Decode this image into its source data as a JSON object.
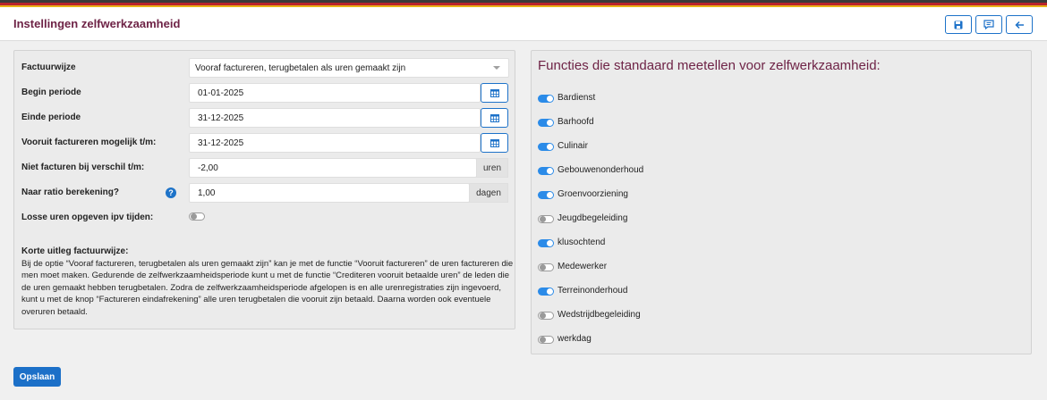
{
  "header": {
    "title": "Instellingen zelfwerkzaamheid",
    "buttons": [
      {
        "icon": "save-icon"
      },
      {
        "icon": "comment-icon"
      },
      {
        "icon": "arrow-left-icon"
      }
    ]
  },
  "colors": {
    "accent": "#1d72c9",
    "title": "#6e2346",
    "toggle_on": "#2b8be8"
  },
  "settings": {
    "factuurwijze": {
      "label": "Factuurwijze",
      "value": "Vooraf factureren, terugbetalen als uren gemaakt zijn"
    },
    "begin_periode": {
      "label": "Begin periode",
      "value": "01-01-2025"
    },
    "einde_periode": {
      "label": "Einde periode",
      "value": "31-12-2025"
    },
    "vooruit": {
      "label": "Vooruit factureren mogelijk t/m:",
      "value": "31-12-2025"
    },
    "niet_facturen": {
      "label": "Niet facturen bij verschil t/m:",
      "value": "-2,00",
      "unit": "uren"
    },
    "ratio": {
      "label": "Naar ratio berekening?",
      "value": "1,00",
      "unit": "dagen"
    },
    "losse_uren": {
      "label": "Losse uren opgeven ipv tijden:",
      "enabled": false
    }
  },
  "explanation": {
    "title": "Korte uitleg factuurwijze:",
    "text": "Bij de optie “Vooraf factureren, terugbetalen als uren gemaakt zijn” kan je met de functie “Vooruit factureren” de uren factureren die men moet maken. Gedurende de zelfwerkzaamheidsperiode kunt u met de functie “Crediteren vooruit betaalde uren” de leden die de uren gemaakt hebben terugbetalen. Zodra de zelfwerkzaamheidsperiode afgelopen is en alle urenregistraties zijn ingevoerd, kunt u met de knop “Factureren eindafrekening” alle uren terugbetalen die vooruit zijn betaald. Daarna worden ook eventuele overuren betaald."
  },
  "functions": {
    "title": "Functies die standaard meetellen voor zelfwerkzaamheid:",
    "items": [
      {
        "label": "Bardienst",
        "on": true
      },
      {
        "label": "Barhoofd",
        "on": true
      },
      {
        "label": "Culinair",
        "on": true
      },
      {
        "label": "Gebouwenonderhoud",
        "on": true
      },
      {
        "label": "Groenvoorziening",
        "on": true
      },
      {
        "label": "Jeugdbegeleiding",
        "on": false
      },
      {
        "label": "klusochtend",
        "on": true
      },
      {
        "label": "Medewerker",
        "on": false
      },
      {
        "label": "Terreinonderhoud",
        "on": true
      },
      {
        "label": "Wedstrijdbegeleiding",
        "on": false
      },
      {
        "label": "werkdag",
        "on": false
      }
    ]
  },
  "footer": {
    "save_label": "Opslaan"
  }
}
